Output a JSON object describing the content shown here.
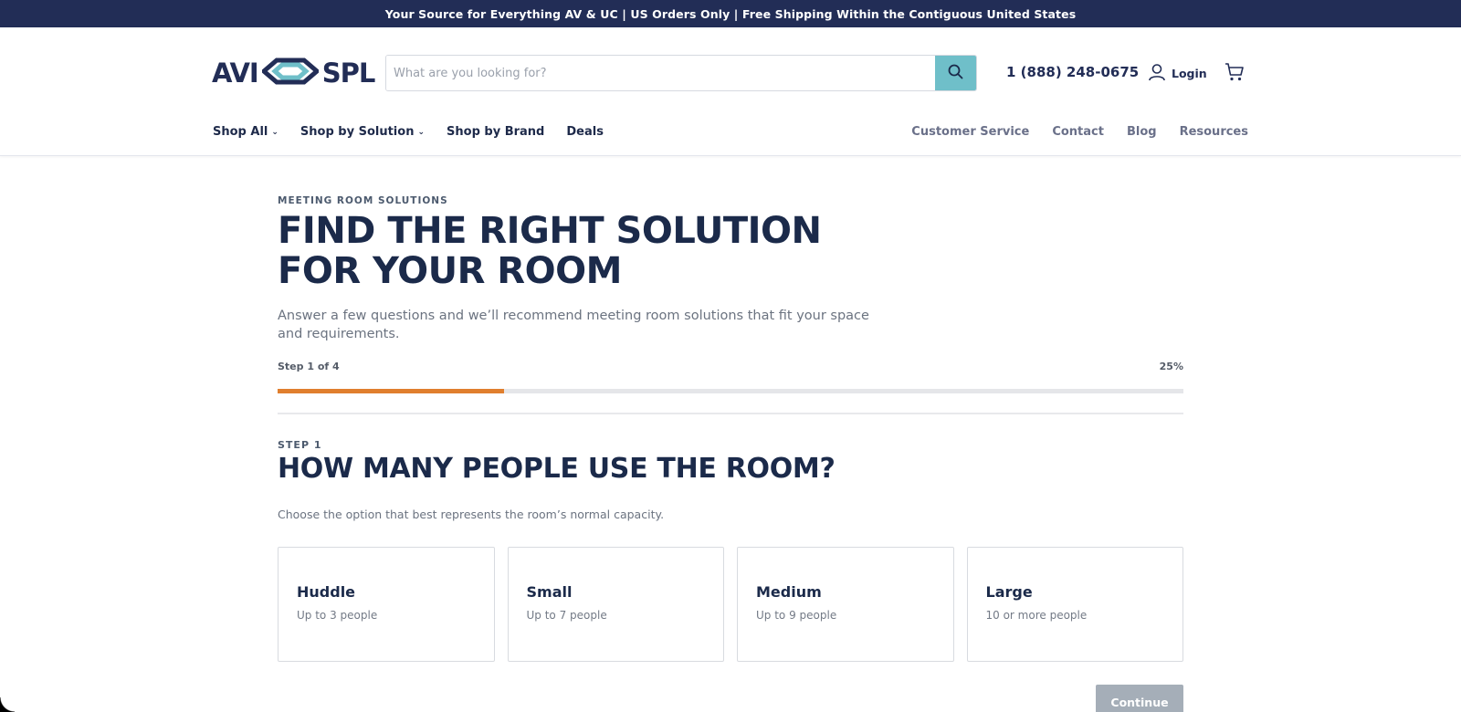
{
  "announcement": "Your Source for Everything AV & UC | US Orders Only | Free Shipping Within the Contiguous United States",
  "brand": {
    "left": "AVI",
    "right": "SPL",
    "navy": "#222d56",
    "teal": "#6fbfc9",
    "accent": "#e07f2e"
  },
  "search": {
    "placeholder": "What are you looking for?",
    "icon": "search-icon"
  },
  "header": {
    "phone": "1 (888) 248-0675",
    "login": "Login",
    "login_icon": "user-icon",
    "cart_icon": "cart-icon"
  },
  "nav": {
    "left": [
      {
        "label": "Shop All",
        "has_dropdown": true
      },
      {
        "label": "Shop by Solution",
        "has_dropdown": true
      },
      {
        "label": "Shop by Brand",
        "has_dropdown": false
      },
      {
        "label": "Deals",
        "has_dropdown": false
      }
    ],
    "right": [
      "Customer Service",
      "Contact",
      "Blog",
      "Resources"
    ]
  },
  "hero": {
    "eyebrow": "MEETING ROOM SOLUTIONS",
    "title": "FIND THE RIGHT SOLUTION FOR YOUR ROOM",
    "subtitle": "Answer a few questions and we’ll recommend meeting room solutions that fit your space and requirements."
  },
  "progress": {
    "step_label": "Step 1 of 4",
    "percent_label": "25%",
    "value": 0.25
  },
  "step": {
    "eyebrow": "STEP 1",
    "question": "HOW MANY PEOPLE USE THE ROOM?",
    "help": "Choose the option that best represents the room’s normal capacity.",
    "options": [
      {
        "title": "Huddle",
        "desc": "Up to 3 people"
      },
      {
        "title": "Small",
        "desc": "Up to 7 people"
      },
      {
        "title": "Medium",
        "desc": "Up to 9 people"
      },
      {
        "title": "Large",
        "desc": "10 or more people"
      }
    ],
    "continue": "Continue"
  }
}
